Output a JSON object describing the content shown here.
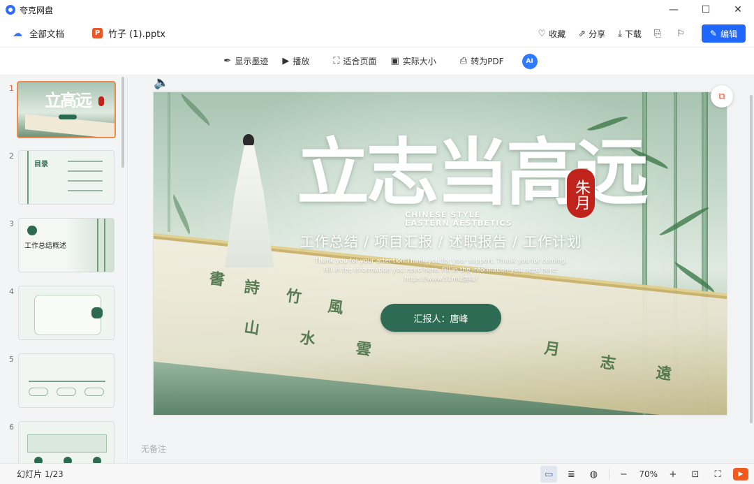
{
  "window": {
    "app_title": "夸克网盘",
    "minimize": "—",
    "maximize": "☐",
    "close": "✕"
  },
  "docbar": {
    "all_docs": "全部文档",
    "file_badge": "P",
    "file_name": "竹子 (1).pptx",
    "actions": {
      "favorite": "收藏",
      "share": "分享",
      "download": "下载"
    },
    "edit_label": "编辑"
  },
  "toolbar": {
    "show_ink": "显示墨迹",
    "play": "播放",
    "fit_page": "适合页面",
    "actual_size": "实际大小",
    "to_pdf": "转为PDF",
    "ai_label": "AI"
  },
  "thumbnails": [
    {
      "num": "1",
      "active": true
    },
    {
      "num": "2",
      "active": false,
      "label": "目录"
    },
    {
      "num": "3",
      "active": false,
      "label": "工作总结概述"
    },
    {
      "num": "4",
      "active": false
    },
    {
      "num": "5",
      "active": false
    },
    {
      "num": "6",
      "active": false
    }
  ],
  "slide": {
    "title": "立志当高远",
    "seal_text": "朱月",
    "style_line1": "CHINESE STYLE",
    "style_line2": "EASTERN AESTBETICS",
    "subtitle": "工作总结 / 项目汇报 / 述职报告 / 工作计划",
    "english_line1": "Thank you for your attention.Thank you for your support. Thank you for coming.",
    "english_line2": "Fill in the information you need here. Fill in the information you need here.",
    "website": "https://www.51miz唐峰/",
    "reporter": "汇报人：唐峰"
  },
  "notes_placeholder": "无备注",
  "statusbar": {
    "slide_count": "幻灯片 1/23",
    "zoom": "70%"
  },
  "colors": {
    "accent_blue": "#1f67ff",
    "active_orange": "#f08a4b",
    "seal_red": "#c0231c",
    "reporter_green": "#2e6b54"
  }
}
